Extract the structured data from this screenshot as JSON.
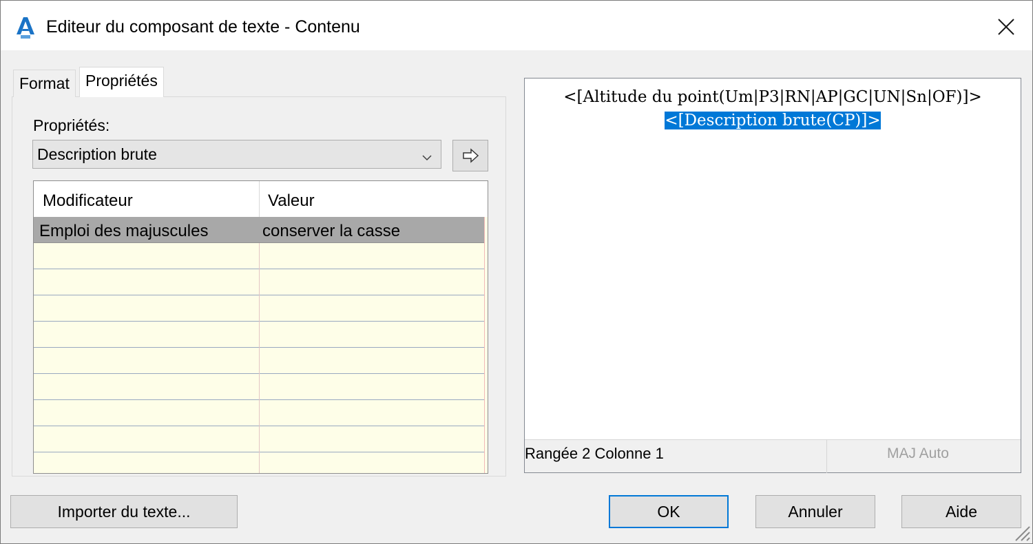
{
  "window": {
    "title": "Editeur du composant de texte - Contenu",
    "app_icon": "autocad-civil3d-icon",
    "close_icon": "close-icon"
  },
  "tabs": [
    {
      "label": "Format",
      "active": false
    },
    {
      "label": "Propriétés",
      "active": true
    }
  ],
  "properties_panel": {
    "label": "Propriétés:",
    "selected_property": "Description brute",
    "insert_button_icon": "arrow-right-icon"
  },
  "modifier_grid": {
    "columns": [
      "Modificateur",
      "Valeur"
    ],
    "rows": [
      {
        "modifier": "Emploi des majuscules",
        "value": "conserver la casse",
        "selected": true
      }
    ],
    "empty_row_count": 9
  },
  "editor": {
    "line1": "<[Altitude du point(Um|P3|RN|AP|GC|UN|Sn|OF)]>",
    "line2_highlighted": "<[Description brute(CP)]>",
    "status_position": "Rangée 2 Colonne 1",
    "status_mode": "MAJ Auto"
  },
  "buttons": {
    "import": "Importer du texte...",
    "ok": "OK",
    "cancel": "Annuler",
    "help": "Aide"
  },
  "colors": {
    "selection_blue": "#0078d7",
    "grid_background": "#fefee8",
    "selected_row": "#a8a8a8",
    "dialog_background": "#f0f0f0"
  }
}
